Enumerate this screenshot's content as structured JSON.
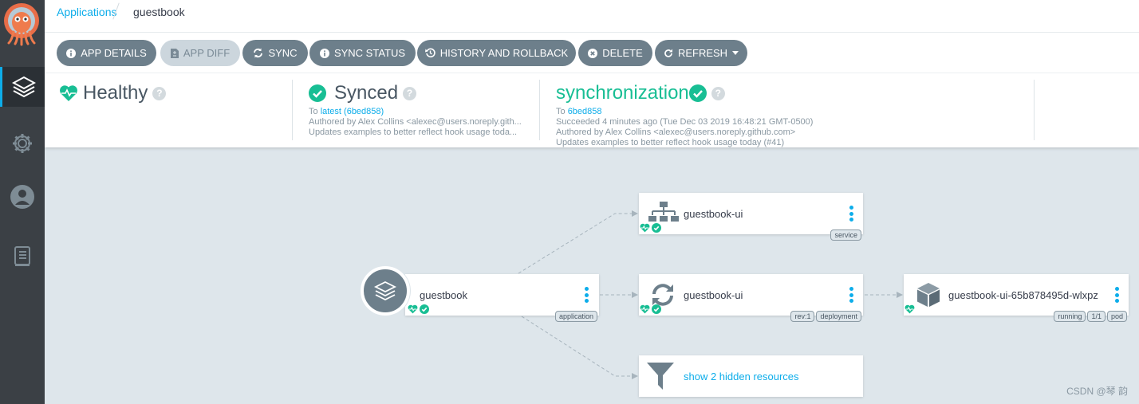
{
  "breadcrumb": {
    "root": "Applications",
    "current": "guestbook"
  },
  "toolbar": {
    "app_details": "APP DETAILS",
    "app_diff": "APP DIFF",
    "sync": "SYNC",
    "sync_status": "SYNC STATUS",
    "history": "HISTORY AND ROLLBACK",
    "delete": "DELETE",
    "refresh": "REFRESH"
  },
  "status": {
    "health": {
      "label": "Healthy"
    },
    "sync": {
      "label": "Synced",
      "to_prefix": "To",
      "revision": "latest (6bed858)",
      "author": "Authored by Alex Collins <alexec@users.noreply.gith...",
      "message": "Updates examples to better reflect hook usage toda..."
    },
    "operation": {
      "label": "synchronization",
      "to_prefix": "To",
      "revision": "6bed858",
      "succeeded": "Succeeded 4 minutes ago (Tue Dec 03 2019 16:48:21 GMT-0500)",
      "author": "Authored by Alex Collins <alexec@users.noreply.github.com>",
      "message": "Updates examples to better reflect hook usage today (#41)"
    }
  },
  "tree": {
    "app": {
      "name": "guestbook",
      "tag": "application"
    },
    "service": {
      "name": "guestbook-ui",
      "tag": "service"
    },
    "deployment": {
      "name": "guestbook-ui",
      "tags": [
        "rev:1",
        "deployment"
      ]
    },
    "pod": {
      "name": "guestbook-ui-65b878495d-wlxpz",
      "tags": [
        "running",
        "1/1",
        "pod"
      ]
    },
    "hidden": {
      "label": "show 2 hidden resources"
    }
  },
  "colors": {
    "accent": "#0dadea",
    "healthy": "#18be94",
    "button": "#6d7f8b",
    "canvas": "#dee6eb"
  },
  "watermark": "CSDN @琴 韵"
}
